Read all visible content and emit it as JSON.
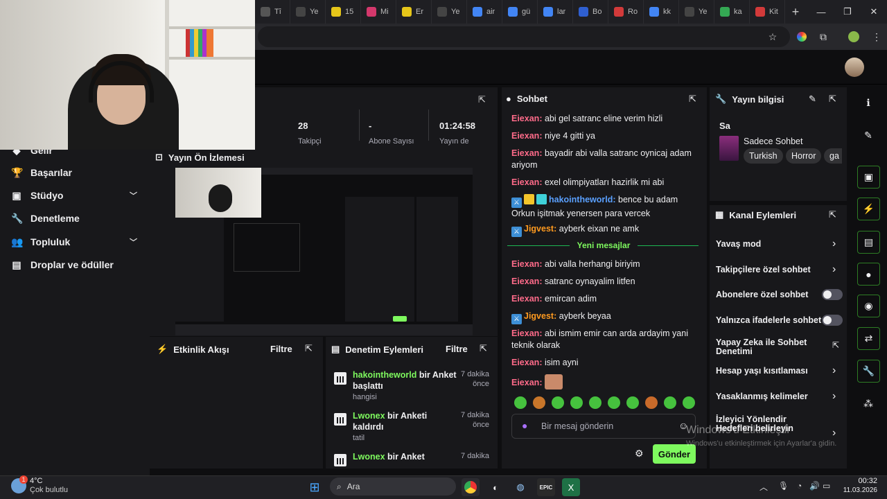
{
  "browser": {
    "tabs": [
      {
        "label": "Tî",
        "color": "#555"
      },
      {
        "label": "Ye",
        "color": "#444"
      },
      {
        "label": "15",
        "color": "#e6c619"
      },
      {
        "label": "Mi",
        "color": "#d4386c"
      },
      {
        "label": "Er",
        "color": "#e6c619"
      },
      {
        "label": "Ye",
        "color": "#444"
      },
      {
        "label": "air",
        "color": "#4285f4"
      },
      {
        "label": "gü",
        "color": "#4285f4"
      },
      {
        "label": "lar",
        "color": "#4285f4"
      },
      {
        "label": "Bo",
        "color": "#2f5fd0"
      },
      {
        "label": "Ro",
        "color": "#d23a3a"
      },
      {
        "label": "kk",
        "color": "#4285f4"
      },
      {
        "label": "Ye",
        "color": "#444"
      },
      {
        "label": "ka",
        "color": "#34a853"
      },
      {
        "label": "Kit",
        "color": "#d23a3a"
      }
    ],
    "new_tab": "+",
    "win_min": "—",
    "win_max": "❐",
    "win_close": "✕"
  },
  "stats": {
    "viewers": "28",
    "subs": "-",
    "uptime": "01:24:58",
    "viewers_label": "Takipçi",
    "subs_label": "Abone Sayısı",
    "uptime_label": "Yayın de"
  },
  "sidebar": {
    "items": [
      {
        "label": "Gelir",
        "icon": "◆"
      },
      {
        "label": "Başarılar",
        "icon": "🏆"
      },
      {
        "label": "Stüdyo",
        "icon": "▣",
        "chevron": true
      },
      {
        "label": "Denetleme",
        "icon": "🔧"
      },
      {
        "label": "Topluluk",
        "icon": "👥",
        "chevron": true
      },
      {
        "label": "Droplar ve ödüller",
        "icon": "▤"
      }
    ]
  },
  "preview": {
    "title": "Yayın Ön İzlemesi"
  },
  "activity": {
    "title": "Etkinlik Akışı",
    "filter": "Filtre"
  },
  "modactions": {
    "title": "Denetim Eylemleri",
    "filter": "Filtre",
    "items": [
      {
        "user": "hakointheworld",
        "action": " bir Anket başlattı",
        "when": "7 dakika önce",
        "sub": "hangisi"
      },
      {
        "user": "Lwonex",
        "action": " bir Anketi kaldırdı",
        "when": "7 dakika önce",
        "sub": "tatil"
      },
      {
        "user": "Lwonex",
        "action": " bir Anket",
        "when": "7 dakika",
        "sub": ""
      }
    ]
  },
  "chat": {
    "title": "Sohbet",
    "messages": [
      {
        "user": "Eiexan",
        "text": " abi gel satranc eline verim hizli",
        "color": "#ff6b8a"
      },
      {
        "user": "Eiexan",
        "text": " niye 4 gitti ya",
        "color": "#ff6b8a"
      },
      {
        "user": "Eiexan",
        "text": " bayadir abi valla satranc oynicaj adam ariyom",
        "color": "#ff6b8a"
      },
      {
        "user": "Eiexan",
        "text": " exel olimpiyatları hazirlik mi abi",
        "color": "#ff6b8a"
      },
      {
        "user": "hakointheworld",
        "text": " bence bu adam Orkun işitmak yenersen para vercek",
        "color": "#5aa0ff"
      },
      {
        "user": "Jigvest",
        "text": " ayberk eixan ne amk",
        "color": "#ff9a1f"
      },
      {
        "user": "Eiexan",
        "text": " abi valla herhangi biriyim",
        "color": "#ff6b8a"
      },
      {
        "user": "Eiexan",
        "text": " satranc oynayalim litfen",
        "color": "#ff6b8a"
      },
      {
        "user": "Eiexan",
        "text": " emircan adim",
        "color": "#ff6b8a"
      },
      {
        "user": "Jigvest",
        "text": " ayberk beyaa",
        "color": "#ff9a1f"
      },
      {
        "user": "Eiexan",
        "text": " abi ismim emir can arda ardayim yani teknik olarak",
        "color": "#ff6b8a"
      },
      {
        "user": "Eiexan",
        "text": " isim ayni",
        "color": "#ff6b8a"
      },
      {
        "user": "Eiexan",
        "text": "",
        "color": "#ff6b8a"
      }
    ],
    "new_messages": "Yeni mesajlar",
    "placeholder": "Bir mesaj gönderin",
    "send": "Gönder"
  },
  "info": {
    "title": "Yayın bilgisi",
    "stream_title": "Sa",
    "category": "Sadece Sohbet",
    "tags": [
      "Turkish",
      "Horror",
      "ga"
    ]
  },
  "channel_actions": {
    "title": "Kanal Eylemleri",
    "items": [
      {
        "label": "Yavaş mod",
        "control": "arrow"
      },
      {
        "label": "Takipçilere özel sohbet",
        "control": "arrow"
      },
      {
        "label": "Abonelere özel sohbet",
        "control": "toggle"
      },
      {
        "label": "Yalnızca ifadelerle sohbet",
        "control": "toggle"
      },
      {
        "label": "Yapay Zeka ile Sohbet Denetimi",
        "control": "external"
      },
      {
        "label": "Hesap yaşı kısıtlaması",
        "control": "arrow"
      },
      {
        "label": "Yasaklanmış kelimeler",
        "control": "arrow"
      },
      {
        "label": "İzleyici Yönlendir Hedefleri belirleyin",
        "control": "arrow"
      }
    ]
  },
  "watermark": {
    "line1": "Windows'u Etkinleştir",
    "line2": "Windows'u etkinleştirmek için Ayarlar'a gidin."
  },
  "taskbar": {
    "weather_temp": "4°C",
    "weather_desc": "Çok bulutlu",
    "search": "Ara",
    "time": "00:32",
    "date": "11.03.2026",
    "badge": "1"
  },
  "colors": {
    "accent": "#7ef95e",
    "bg": "#0e0e10",
    "panel": "#18181b"
  }
}
